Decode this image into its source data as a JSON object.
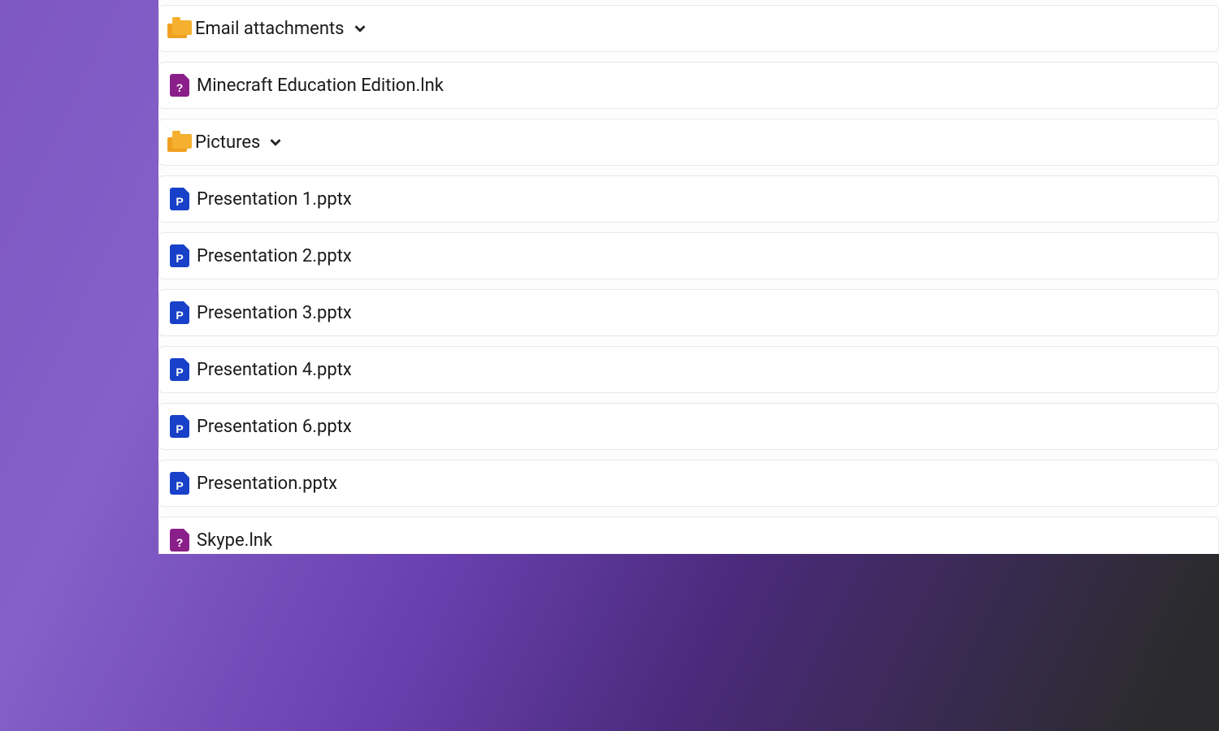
{
  "items": [
    {
      "type": "folder",
      "name": "Email attachments"
    },
    {
      "type": "file",
      "icon": "unknown",
      "name": "Minecraft Education Edition.lnk"
    },
    {
      "type": "folder",
      "name": "Pictures"
    },
    {
      "type": "file",
      "icon": "pptx",
      "name": "Presentation 1.pptx"
    },
    {
      "type": "file",
      "icon": "pptx",
      "name": "Presentation 2.pptx"
    },
    {
      "type": "file",
      "icon": "pptx",
      "name": "Presentation 3.pptx"
    },
    {
      "type": "file",
      "icon": "pptx",
      "name": "Presentation 4.pptx"
    },
    {
      "type": "file",
      "icon": "pptx",
      "name": "Presentation 6.pptx"
    },
    {
      "type": "file",
      "icon": "pptx",
      "name": "Presentation.pptx"
    },
    {
      "type": "file",
      "icon": "unknown",
      "name": "Skype.lnk"
    }
  ]
}
